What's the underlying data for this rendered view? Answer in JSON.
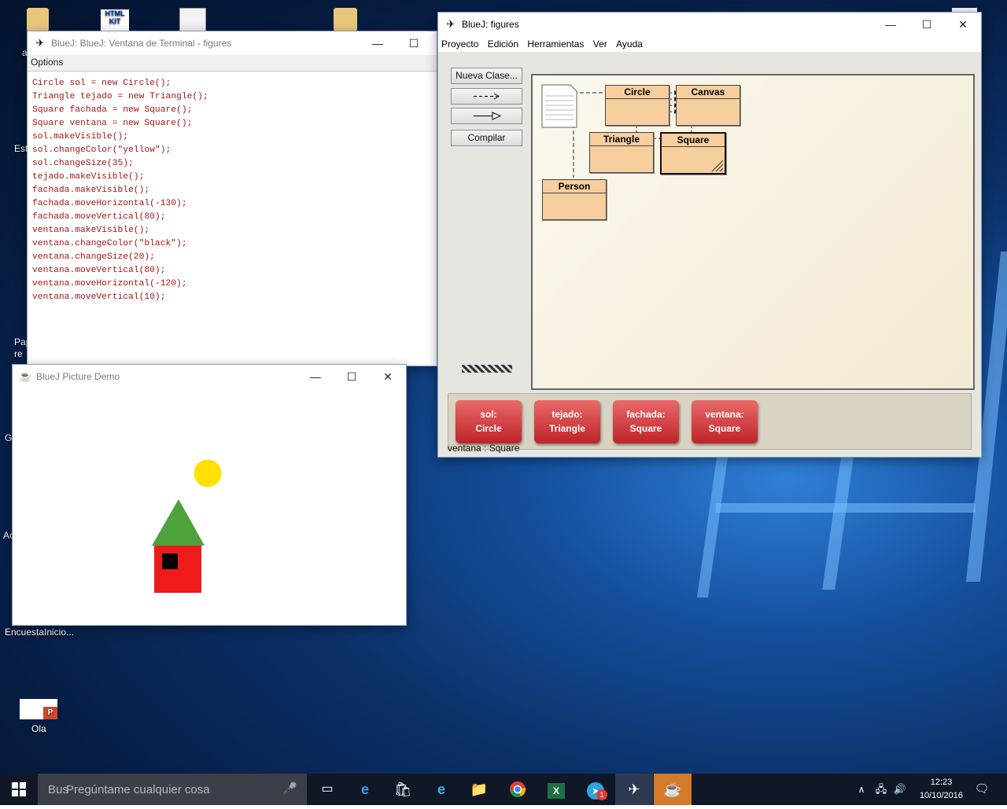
{
  "desktop": {
    "icons": [
      {
        "label": "a",
        "name": "folder-user-icon"
      },
      {
        "label": "Est",
        "name": "desktop-shortcut-icon"
      },
      {
        "label": "Pap\nre",
        "name": "recycle-bin-icon"
      },
      {
        "label": "G",
        "name": "desktop-shortcut-icon-2"
      },
      {
        "label": "Ac",
        "name": "desktop-shortcut-icon-3"
      },
      {
        "label": "EncuestaInicio...",
        "name": "survey-shortcut-icon"
      },
      {
        "label": "Ola",
        "name": "powerpoint-file-icon"
      }
    ],
    "html_kit_label": "HTML\nKIT"
  },
  "terminal": {
    "title": "BlueJ: BlueJ:  Ventana de Terminal - figures",
    "menu": [
      "Options"
    ],
    "lines": [
      "Circle sol = new Circle();",
      "Triangle tejado = new Triangle();",
      "Square fachada = new Square();",
      "Square ventana = new Square();",
      "sol.makeVisible();",
      "sol.changeColor(\"yellow\");",
      "sol.changeSize(35);",
      "tejado.makeVisible();",
      "fachada.makeVisible();",
      "fachada.moveHorizontal(-130);",
      "fachada.moveVertical(80);",
      "ventana.makeVisible();",
      "ventana.changeColor(\"black\");",
      "ventana.changeSize(20);",
      "ventana.moveVertical(80);",
      "ventana.moveHorizontal(-120);",
      "ventana.moveVertical(10);"
    ]
  },
  "demo": {
    "title": "BlueJ Picture Demo",
    "colors": {
      "sun": "#ffe000",
      "roof": "#4ea23b",
      "wall": "#ef1b1b",
      "window": "#000000"
    }
  },
  "bluej": {
    "title": "BlueJ:  figures",
    "menu": [
      "Proyecto",
      "Edición",
      "Herramientas",
      "Ver",
      "Ayuda"
    ],
    "buttons": {
      "new_class": "Nueva Clase...",
      "dep_arrow": "--->",
      "inh_arrow": "—▷",
      "compile": "Compilar"
    },
    "classes": [
      "Circle",
      "Canvas",
      "Triangle",
      "Square",
      "Person"
    ],
    "objects": [
      {
        "name": "sol:",
        "type": "Circle"
      },
      {
        "name": "tejado:",
        "type": "Triangle"
      },
      {
        "name": "fachada:",
        "type": "Square"
      },
      {
        "name": "ventana:",
        "type": "Square"
      }
    ],
    "status": "ventana : Square",
    "colors": {
      "class_fill": "#f7ce9e",
      "object_fill": "#d8343a"
    }
  },
  "taskbar": {
    "search_prefix": "Bus",
    "search_placeholder": "Pregúntame cualquier cosa",
    "apps": [
      "task-view-icon",
      "edge-icon",
      "store-icon",
      "ie-icon",
      "explorer-icon",
      "chrome-icon",
      "excel-icon",
      "telegram-icon",
      "bluej-icon",
      "java-icon"
    ],
    "telegram_badge": "1",
    "time": "12:23",
    "date": "10/10/2016"
  }
}
